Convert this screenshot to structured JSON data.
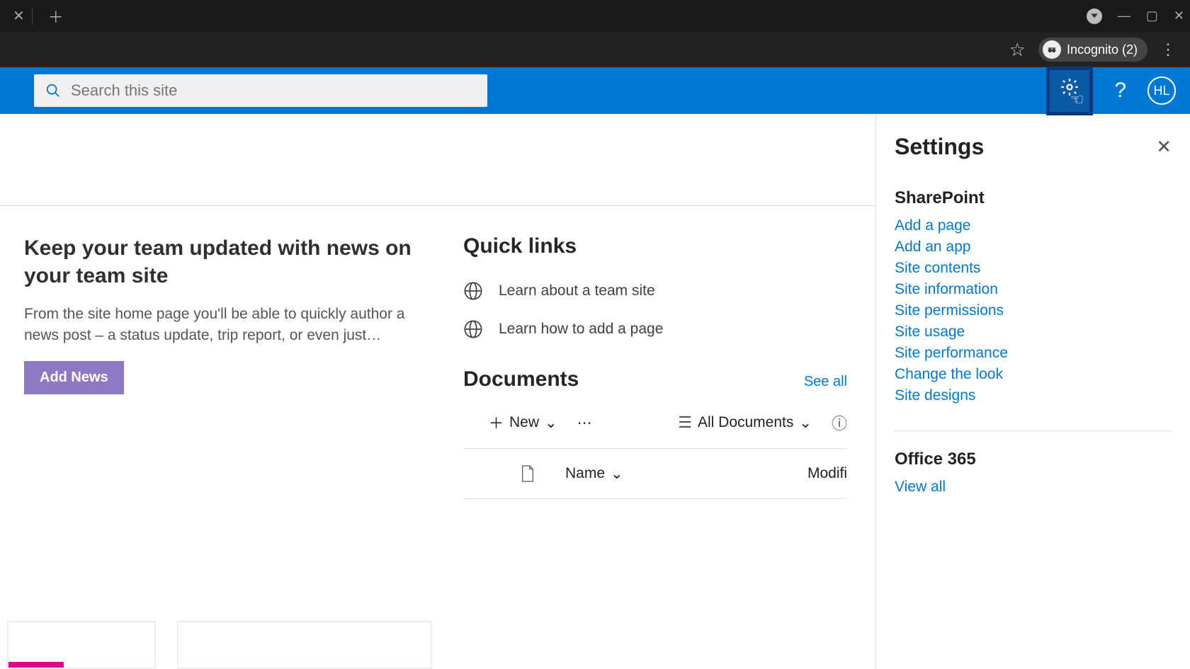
{
  "browser": {
    "incognito_label": "Incognito (2)"
  },
  "search": {
    "placeholder": "Search this site"
  },
  "avatar_initials": "HL",
  "news": {
    "title": "Keep your team updated with news on your team site",
    "description": "From the site home page you'll be able to quickly author a news post – a status update, trip report, or even just…",
    "button": "Add News"
  },
  "quicklinks": {
    "title": "Quick links",
    "items": [
      {
        "label": "Learn about a team site"
      },
      {
        "label": "Learn how to add a page"
      }
    ]
  },
  "documents": {
    "title": "Documents",
    "see_all": "See all",
    "new_label": "New",
    "view_label": "All Documents",
    "col_name": "Name",
    "col_modified": "Modifi"
  },
  "settings": {
    "title": "Settings",
    "sharepoint_heading": "SharePoint",
    "links": [
      "Add a page",
      "Add an app",
      "Site contents",
      "Site information",
      "Site permissions",
      "Site usage",
      "Site performance",
      "Change the look",
      "Site designs"
    ],
    "office_heading": "Office 365",
    "office_link": "View all"
  }
}
